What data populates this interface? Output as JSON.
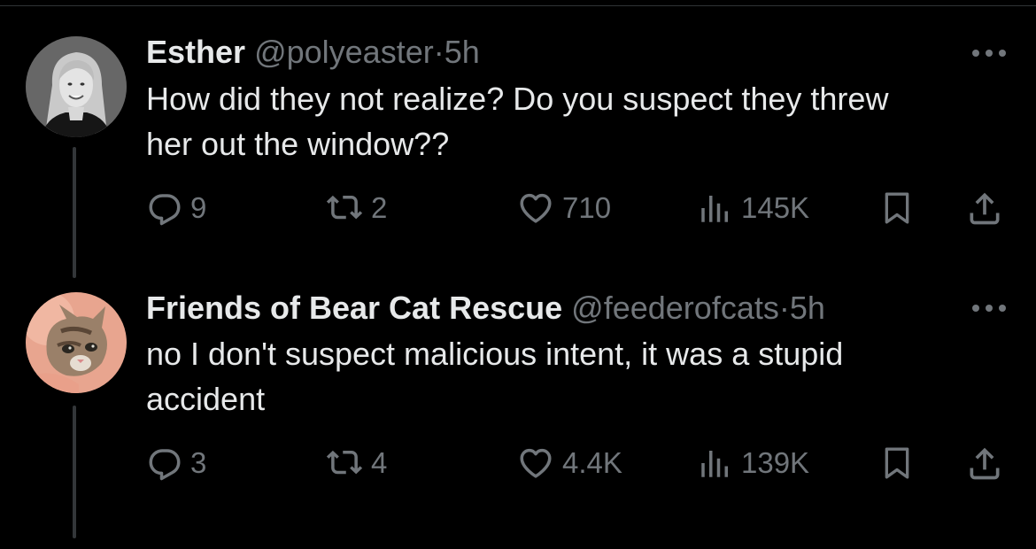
{
  "tweets": [
    {
      "name": "Esther",
      "handle": "@polyeaster",
      "separator": "·",
      "time": "5h",
      "text_lines": [
        "How did they not realize? Do you suspect they threw",
        "her out the window??"
      ],
      "counts": {
        "replies": "9",
        "reposts": "2",
        "likes": "710",
        "views": "145K"
      },
      "avatar_icon": "woman-portrait-avatar"
    },
    {
      "name": "Friends of Bear Cat Rescue",
      "handle": "@feederofcats",
      "separator": "·",
      "time": "5h",
      "text_lines": [
        "no I don't suspect malicious intent, it was a stupid",
        "accident"
      ],
      "counts": {
        "replies": "3",
        "reposts": "4",
        "likes": "4.4K",
        "views": "139K"
      },
      "avatar_icon": "kitten-avatar"
    }
  ],
  "icons": {
    "reply": "speech-bubble-icon",
    "repost": "repost-arrows-icon",
    "like": "heart-icon",
    "views": "bar-chart-icon",
    "bookmark": "bookmark-icon",
    "share": "share-upload-icon",
    "more": "ellipsis-icon"
  },
  "colors": {
    "background": "#000000",
    "primary_text": "#e7e9ea",
    "secondary_text": "#71767b",
    "thread_line": "#333639"
  }
}
